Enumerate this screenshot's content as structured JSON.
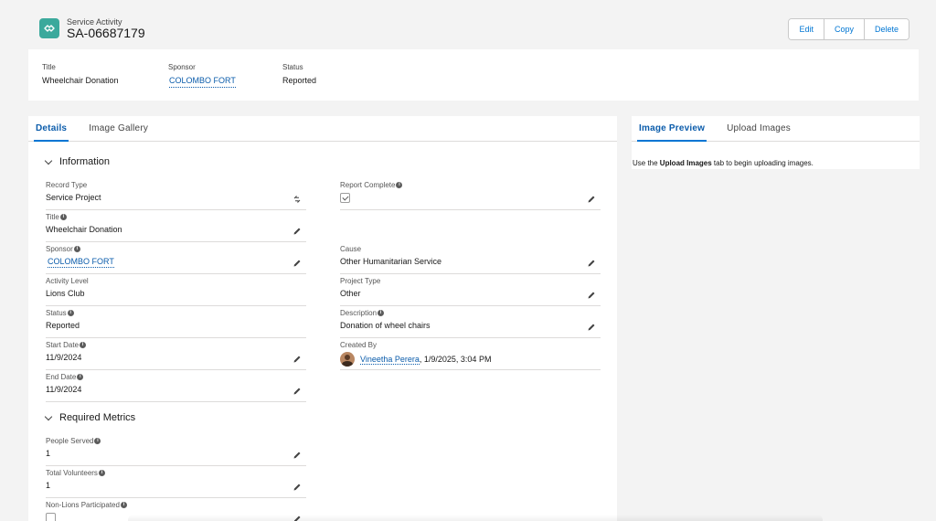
{
  "header": {
    "object_type": "Service Activity",
    "record_name": "SA-06687179",
    "buttons": {
      "edit": "Edit",
      "copy": "Copy",
      "delete": "Delete"
    }
  },
  "highlights": {
    "title_label": "Title",
    "title_value": "Wheelchair Donation",
    "sponsor_label": "Sponsor",
    "sponsor_value": "COLOMBO FORT",
    "status_label": "Status",
    "status_value": "Reported"
  },
  "left_tabs": [
    "Details",
    "Image Gallery"
  ],
  "right_tabs": [
    "Image Preview",
    "Upload Images"
  ],
  "sections": {
    "information": "Information",
    "required_metrics": "Required Metrics"
  },
  "fields": {
    "record_type": {
      "label": "Record Type",
      "value": "Service Project"
    },
    "title": {
      "label": "Title",
      "value": "Wheelchair Donation"
    },
    "sponsor": {
      "label": "Sponsor",
      "value": "COLOMBO FORT"
    },
    "activity_level": {
      "label": "Activity Level",
      "value": "Lions Club"
    },
    "status": {
      "label": "Status",
      "value": "Reported"
    },
    "start_date": {
      "label": "Start Date",
      "value": "11/9/2024"
    },
    "end_date": {
      "label": "End Date",
      "value": "11/9/2024"
    },
    "report_complete": {
      "label": "Report Complete",
      "checked": true
    },
    "cause": {
      "label": "Cause",
      "value": "Other Humanitarian Service"
    },
    "project_type": {
      "label": "Project Type",
      "value": "Other"
    },
    "description": {
      "label": "Description",
      "value": "Donation of wheel chairs"
    },
    "created_by": {
      "label": "Created By",
      "user": "Vineetha Perera",
      "date": ", 1/9/2025, 3:04 PM"
    },
    "people_served": {
      "label": "People Served",
      "value": "1"
    },
    "total_volunteers": {
      "label": "Total Volunteers",
      "value": "1"
    },
    "non_lions": {
      "label": "Non-Lions Participated",
      "checked": false
    }
  },
  "right_panel": {
    "msg_prefix": "Use the ",
    "msg_bold": "Upload Images",
    "msg_suffix": " tab to begin uploading images."
  },
  "colors": {
    "brand": "#0176d3",
    "link": "#0b5cab",
    "object_icon": "#3ba99c"
  }
}
